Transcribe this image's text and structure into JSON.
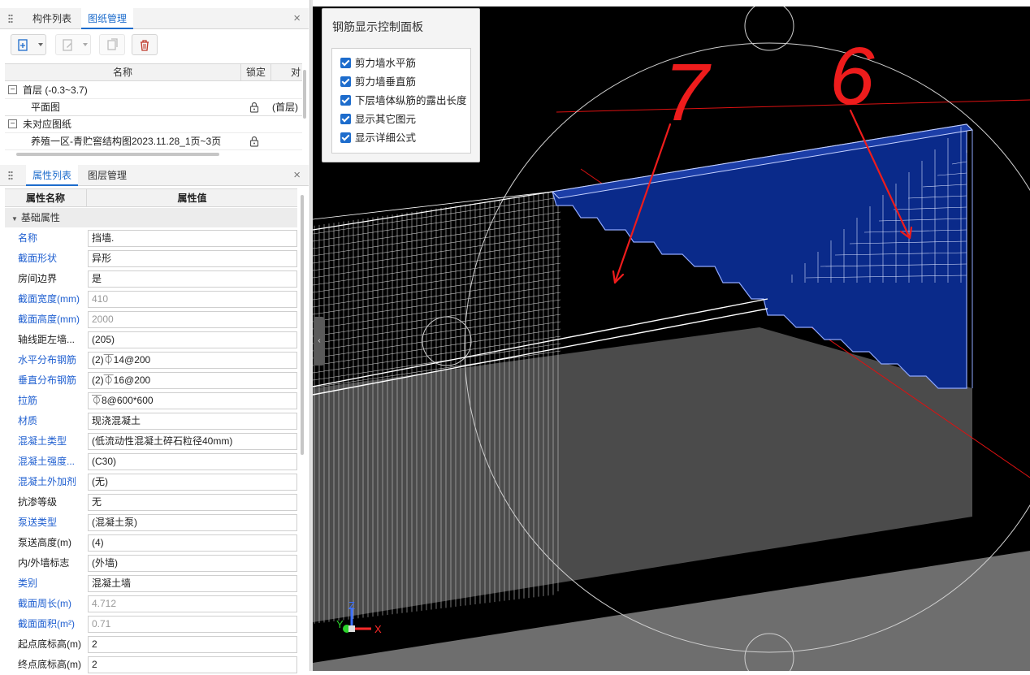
{
  "top_panel": {
    "tabs": [
      "构件列表",
      "图纸管理"
    ],
    "active_tab": 1,
    "columns": {
      "name": "名称",
      "lock": "锁定",
      "extra": "对"
    },
    "rows": [
      {
        "toggle": "−",
        "label": "首层 (-0.3~3.7)"
      },
      {
        "label": "平面图",
        "extra": "(首层)"
      },
      {
        "toggle": "−",
        "label": "未对应图纸"
      },
      {
        "label": "养殖一区-青贮窖结构图2023.11.28_1页~3页"
      }
    ]
  },
  "bottom_panel": {
    "tabs": [
      "属性列表",
      "图层管理"
    ],
    "active_tab": 0,
    "header": {
      "name": "属性名称",
      "value": "属性值"
    },
    "group": "基础属性",
    "rows": [
      {
        "name": "名称",
        "value": "挡墙.",
        "blue": true,
        "gray": false
      },
      {
        "name": "截面形状",
        "value": "异形",
        "blue": true,
        "gray": false
      },
      {
        "name": "房间边界",
        "value": "是",
        "blue": false,
        "gray": false
      },
      {
        "name": "截面宽度(mm)",
        "value": "410",
        "blue": true,
        "gray": true
      },
      {
        "name": "截面高度(mm)",
        "value": "2000",
        "blue": true,
        "gray": true
      },
      {
        "name": "轴线距左墙...",
        "value": "(205)",
        "blue": false,
        "gray": false
      },
      {
        "name": "水平分布钢筋",
        "value": "(2)⏁14@200",
        "blue": true,
        "gray": false
      },
      {
        "name": "垂直分布钢筋",
        "value": "(2)⏁16@200",
        "blue": true,
        "gray": false
      },
      {
        "name": "拉筋",
        "value": "⏁8@600*600",
        "blue": true,
        "gray": false
      },
      {
        "name": "材质",
        "value": "现浇混凝土",
        "blue": true,
        "gray": false
      },
      {
        "name": "混凝土类型",
        "value": "(低流动性混凝土碎石粒径40mm)",
        "blue": true,
        "gray": false
      },
      {
        "name": "混凝土强度...",
        "value": "(C30)",
        "blue": true,
        "gray": false
      },
      {
        "name": "混凝土外加剂",
        "value": "(无)",
        "blue": true,
        "gray": false
      },
      {
        "name": "抗渗等级",
        "value": "无",
        "blue": false,
        "gray": false
      },
      {
        "name": "泵送类型",
        "value": "(混凝土泵)",
        "blue": true,
        "gray": false
      },
      {
        "name": "泵送高度(m)",
        "value": "(4)",
        "blue": false,
        "gray": false
      },
      {
        "name": "内/外墙标志",
        "value": "(外墙)",
        "blue": false,
        "gray": false
      },
      {
        "name": "类别",
        "value": "混凝土墙",
        "blue": true,
        "gray": false
      },
      {
        "name": "截面周长(m)",
        "value": "4.712",
        "blue": true,
        "gray": true
      },
      {
        "name": "截面面积(m²)",
        "value": "0.71",
        "blue": true,
        "gray": true
      },
      {
        "name": "起点底标高(m)",
        "value": "2",
        "blue": false,
        "gray": false
      },
      {
        "name": "终点底标高(m)",
        "value": "2",
        "blue": false,
        "gray": false
      }
    ]
  },
  "rebar_panel": {
    "title": "钢筋显示控制面板",
    "options": [
      {
        "label": "剪力墙水平筋",
        "checked": true
      },
      {
        "label": "剪力墙垂直筋",
        "checked": true
      },
      {
        "label": "下层墙体纵筋的露出长度",
        "checked": true
      },
      {
        "label": "显示其它图元",
        "checked": true
      },
      {
        "label": "显示详细公式",
        "checked": true
      }
    ]
  },
  "viewport": {
    "annotations": {
      "left": "7",
      "right": "6"
    },
    "axes": {
      "x": "X",
      "y": "Y",
      "z": "Z"
    },
    "colors": {
      "wall_fill": "#0a2a8a",
      "annotation": "#ee1c1c",
      "background": "#000000"
    }
  }
}
